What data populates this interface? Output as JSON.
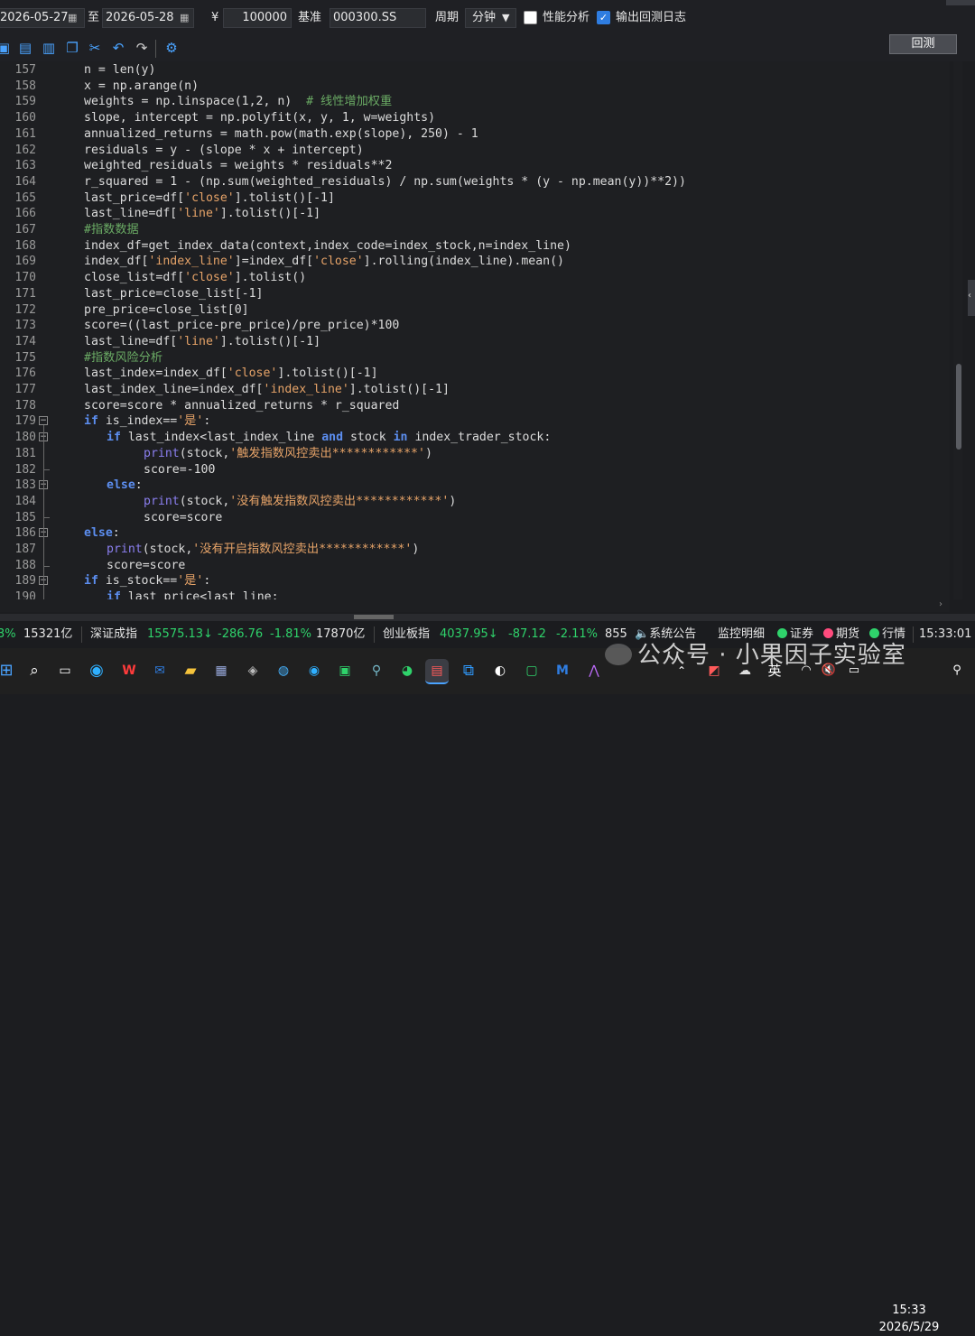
{
  "header": {
    "start_date": "2026-05-27",
    "to_label": "至",
    "end_date": "2026-05-28",
    "currency_symbol": "¥",
    "capital": "100000",
    "benchmark_label": "基准",
    "benchmark": "000300.SS",
    "period_label": "周期",
    "period_value": "分钟",
    "perf_analysis_label": "性能分析",
    "perf_analysis_checked": false,
    "log_label": "输出回测日志",
    "log_checked": true
  },
  "toolbar": {
    "icons": [
      "open-icon",
      "save-icon",
      "save-as-icon",
      "copy-icon",
      "cut-icon",
      "undo-icon",
      "redo-icon",
      "settings-icon"
    ],
    "run_label": "回测"
  },
  "code_lines": [
    {
      "n": "157",
      "indent": 0,
      "parts": [
        [
          "n = len(y)",
          ""
        ]
      ]
    },
    {
      "n": "158",
      "indent": 0,
      "parts": [
        [
          "x = np.arange(n)",
          ""
        ]
      ]
    },
    {
      "n": "159",
      "indent": 0,
      "parts": [
        [
          "weights = np.linspace(1,2, n)  ",
          ""
        ],
        [
          "# 线性增加权重",
          "cm"
        ]
      ]
    },
    {
      "n": "160",
      "indent": 0,
      "parts": [
        [
          "slope, intercept = np.polyfit(x, y, 1, w=weights)",
          ""
        ]
      ]
    },
    {
      "n": "161",
      "indent": 0,
      "parts": [
        [
          "annualized_returns = math.pow(math.exp(slope), 250) - 1",
          ""
        ]
      ]
    },
    {
      "n": "162",
      "indent": 0,
      "parts": [
        [
          "residuals = y - (slope * x + intercept)",
          ""
        ]
      ]
    },
    {
      "n": "163",
      "indent": 0,
      "parts": [
        [
          "weighted_residuals = weights * residuals**2",
          ""
        ]
      ]
    },
    {
      "n": "164",
      "indent": 0,
      "parts": [
        [
          "r_squared = 1 - (np.sum(weighted_residuals) / np.sum(weights * (y - np.mean(y))**2))",
          ""
        ]
      ]
    },
    {
      "n": "165",
      "indent": 0,
      "parts": [
        [
          "last_price=df[",
          ""
        ],
        [
          "'close'",
          "str"
        ],
        [
          "].tolist()[-1]",
          ""
        ]
      ]
    },
    {
      "n": "166",
      "indent": 0,
      "parts": [
        [
          "last_line=df[",
          ""
        ],
        [
          "'line'",
          "str"
        ],
        [
          "].tolist()[-1]",
          ""
        ]
      ]
    },
    {
      "n": "167",
      "indent": 0,
      "parts": [
        [
          "#指数数据",
          "cm"
        ]
      ]
    },
    {
      "n": "168",
      "indent": 0,
      "parts": [
        [
          "index_df=get_index_data(context,index_code=index_stock,n=index_line)",
          ""
        ]
      ]
    },
    {
      "n": "169",
      "indent": 0,
      "parts": [
        [
          "index_df[",
          ""
        ],
        [
          "'index_line'",
          "str"
        ],
        [
          "]=index_df[",
          ""
        ],
        [
          "'close'",
          "str"
        ],
        [
          "].rolling(index_line).mean()",
          ""
        ]
      ]
    },
    {
      "n": "170",
      "indent": 0,
      "parts": [
        [
          "close_list=df[",
          ""
        ],
        [
          "'close'",
          "str"
        ],
        [
          "].tolist()",
          ""
        ]
      ]
    },
    {
      "n": "171",
      "indent": 0,
      "parts": [
        [
          "last_price=close_list[-1]",
          ""
        ]
      ]
    },
    {
      "n": "172",
      "indent": 0,
      "parts": [
        [
          "pre_price=close_list[0]",
          ""
        ]
      ]
    },
    {
      "n": "173",
      "indent": 0,
      "parts": [
        [
          "score=((last_price-pre_price)/pre_price)*100",
          ""
        ]
      ]
    },
    {
      "n": "174",
      "indent": 0,
      "parts": [
        [
          "last_line=df[",
          ""
        ],
        [
          "'line'",
          "str"
        ],
        [
          "].tolist()[-1]",
          ""
        ]
      ]
    },
    {
      "n": "175",
      "indent": 0,
      "parts": [
        [
          "#指数风险分析",
          "cm"
        ]
      ]
    },
    {
      "n": "176",
      "indent": 0,
      "parts": [
        [
          "last_index=index_df[",
          ""
        ],
        [
          "'close'",
          "str"
        ],
        [
          "].tolist()[-1]",
          ""
        ]
      ]
    },
    {
      "n": "177",
      "indent": 0,
      "parts": [
        [
          "last_index_line=index_df[",
          ""
        ],
        [
          "'index_line'",
          "str"
        ],
        [
          "].tolist()[-1]",
          ""
        ]
      ]
    },
    {
      "n": "178",
      "indent": 0,
      "parts": [
        [
          "score=score * annualized_returns * r_squared",
          ""
        ]
      ]
    },
    {
      "n": "179",
      "indent": 0,
      "fold": "open",
      "parts": [
        [
          "if",
          "kw"
        ],
        [
          " is_index==",
          ""
        ],
        [
          "'是'",
          "str"
        ],
        [
          ":",
          ""
        ]
      ]
    },
    {
      "n": "180",
      "indent": 1,
      "fold": "open",
      "parts": [
        [
          "if",
          "kw"
        ],
        [
          " last_index<last_index_line ",
          ""
        ],
        [
          "and",
          "kw"
        ],
        [
          " stock ",
          ""
        ],
        [
          "in",
          "kw"
        ],
        [
          " index_trader_stock:",
          ""
        ]
      ]
    },
    {
      "n": "181",
      "indent": 2,
      "parts": [
        [
          "print",
          "fn"
        ],
        [
          "(stock,",
          ""
        ],
        [
          "'触发指数风控卖出************'",
          "str"
        ],
        [
          ")",
          ""
        ]
      ]
    },
    {
      "n": "182",
      "indent": 2,
      "fold": "end",
      "parts": [
        [
          "score=-100",
          ""
        ]
      ]
    },
    {
      "n": "183",
      "indent": 1,
      "fold": "open",
      "parts": [
        [
          "else",
          "kw"
        ],
        [
          ":",
          ""
        ]
      ]
    },
    {
      "n": "184",
      "indent": 2,
      "parts": [
        [
          "print",
          "fn"
        ],
        [
          "(stock,",
          ""
        ],
        [
          "'没有触发指数风控卖出************'",
          "str"
        ],
        [
          ")",
          ""
        ]
      ]
    },
    {
      "n": "185",
      "indent": 2,
      "fold": "end",
      "parts": [
        [
          "score=score",
          ""
        ]
      ]
    },
    {
      "n": "186",
      "indent": 0,
      "fold": "open",
      "parts": [
        [
          "else",
          "kw"
        ],
        [
          ":",
          ""
        ]
      ]
    },
    {
      "n": "187",
      "indent": 1,
      "parts": [
        [
          "print",
          "fn"
        ],
        [
          "(stock,",
          ""
        ],
        [
          "'没有开启指数风控卖出************'",
          "str"
        ],
        [
          ")",
          ""
        ]
      ]
    },
    {
      "n": "188",
      "indent": 1,
      "fold": "end",
      "parts": [
        [
          "score=score",
          ""
        ]
      ]
    },
    {
      "n": "189",
      "indent": 0,
      "fold": "open",
      "parts": [
        [
          "if",
          "kw"
        ],
        [
          " is_stock==",
          ""
        ],
        [
          "'是'",
          "str"
        ],
        [
          ":",
          ""
        ]
      ]
    },
    {
      "n": "190",
      "indent": 1,
      "parts": [
        [
          "if",
          "kw"
        ],
        [
          " last_price<last_line:",
          ""
        ]
      ]
    }
  ],
  "status": {
    "item0_pct": "3%",
    "item0_vol": "15321亿",
    "szcz_name": "深证成指",
    "szcz_price": "15575.13",
    "szcz_arrow": "↓",
    "szcz_change": "-286.76",
    "szcz_pct": "-1.81%",
    "szcz_vol": "17870亿",
    "cyb_name": "创业板指",
    "cyb_price": "4037.95",
    "cyb_arrow": "↓",
    "cyb_change": "-87.12",
    "cyb_pct": "-2.11%",
    "cyb_vol": "855",
    "announce": "系统公告",
    "monitor": "监控明细",
    "conn_stock": "证券",
    "conn_futures": "期货",
    "conn_quote": "行情",
    "clock": "15:33:01",
    "green": "#2fd36b"
  },
  "watermark": "公众号 · 小果因子实验室",
  "taskbar": {
    "ime": "英",
    "time": "15:33",
    "date": "2026/5/29"
  }
}
